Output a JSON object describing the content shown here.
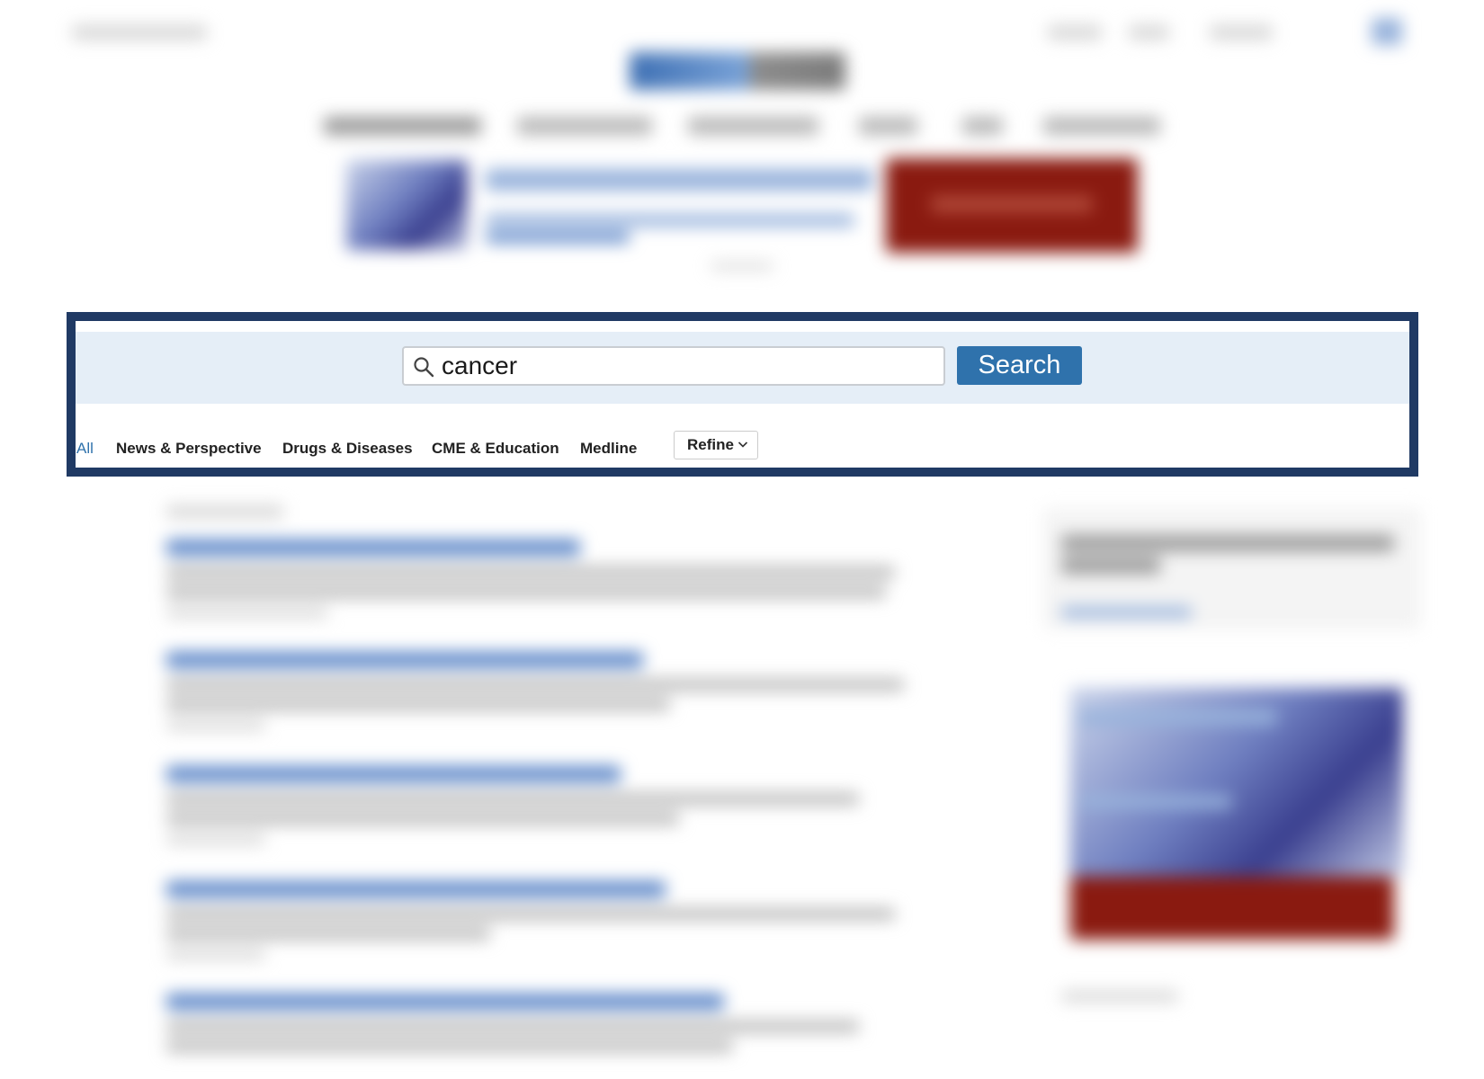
{
  "search": {
    "query": "cancer",
    "button_label": "Search"
  },
  "tabs": [
    {
      "label": "All",
      "active": true
    },
    {
      "label": "News & Perspective",
      "active": false
    },
    {
      "label": "Drugs & Diseases",
      "active": false
    },
    {
      "label": "CME & Education",
      "active": false
    },
    {
      "label": "Medline",
      "active": false
    }
  ],
  "refine": {
    "label": "Refine"
  },
  "colors": {
    "focus_frame": "#203a64",
    "search_band": "#e5eef7",
    "accent": "#2f72ac"
  },
  "icons": {
    "search": "search-icon",
    "refine_toggle": "chevron-down-icon"
  }
}
